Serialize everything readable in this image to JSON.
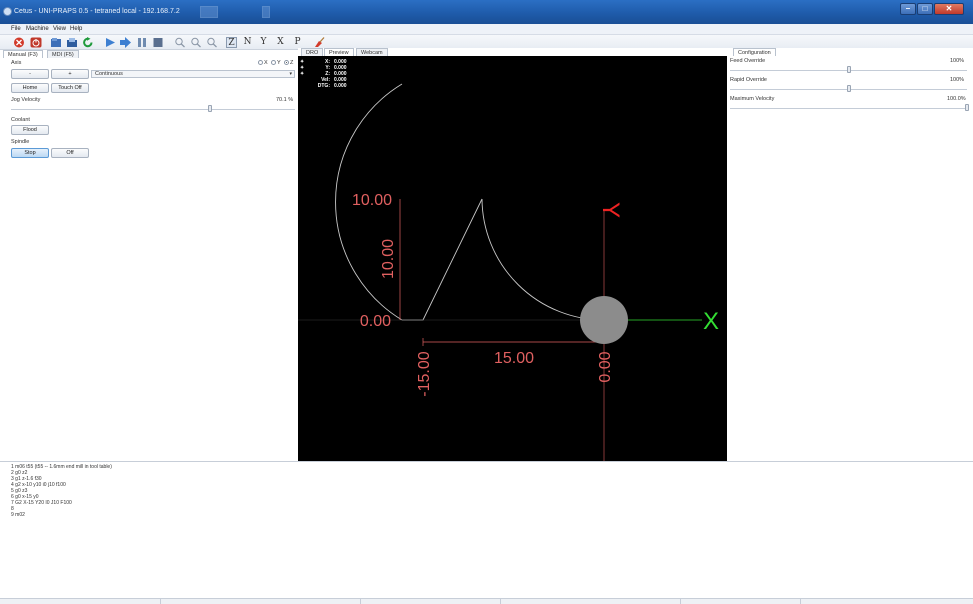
{
  "window": {
    "title": "Cetus - UNI-PRAPS 0.5 - tetraned local - 192.168.7.2"
  },
  "menu": [
    "File",
    "Machine",
    "View",
    "Help"
  ],
  "toolbar": {
    "view_letters": [
      "Z",
      "N",
      "Y",
      "X",
      "P"
    ]
  },
  "left_panel": {
    "tabs": [
      "Manual (F3)",
      "MDI (F5)"
    ],
    "axis_label": "Axis",
    "axis_options": [
      "X",
      "Y",
      "Z"
    ],
    "axis_selected": "Z",
    "jog_minus": "-",
    "jog_plus": "+",
    "jog_mode": "Continuous",
    "home_button": "Home",
    "touch_off_button": "Touch Off",
    "jog_velocity_label": "Jog Velocity",
    "jog_velocity_value": "70.1 %",
    "jog_velocity_fraction": 0.7,
    "coolant_label": "Coolant",
    "flood_button": "Flood",
    "spindle_label": "Spindle",
    "spindle_stop": "Stop",
    "spindle_off": "Off"
  },
  "viewport": {
    "tabs": [
      "DRO",
      "Preview",
      "Webcam"
    ],
    "selected_tab": "Preview",
    "dro": [
      {
        "key": "X:",
        "value": "0.000"
      },
      {
        "key": "Y:",
        "value": "0.000"
      },
      {
        "key": "Z:",
        "value": "0.000"
      },
      {
        "key": "Vel:",
        "value": "0.000"
      },
      {
        "key": "DTG:",
        "value": "0.000"
      }
    ],
    "dims": {
      "height_value": "10.00",
      "height_vertical": "10.00",
      "zero_y": "0.00",
      "x_min": "-15.00",
      "x_span": "15.00",
      "x_zero": "0.00"
    },
    "axis_x_label": "X",
    "axis_y_label": "Y",
    "colors": {
      "background": "#000000",
      "toolpath": "#c8c8c8",
      "dimension": "#e06060",
      "axis_x": "#33dd33",
      "axis_y": "#ee2222",
      "tool": "#8c8c8c"
    }
  },
  "right_panel": {
    "tab": "Configuration",
    "feed_override_label": "Feed Override",
    "feed_override_value": "100%",
    "feed_override_fraction": 0.5,
    "rapid_override_label": "Rapid Override",
    "rapid_override_value": "100%",
    "rapid_override_fraction": 0.5,
    "max_velocity_label": "Maximum Velocity",
    "max_velocity_value": "100.0%",
    "max_velocity_fraction": 1.0
  },
  "gcode": {
    "lines": [
      "1  m06 t55 (t55 -- 1.6mm end mill in tool table)",
      "2  g0 z2",
      "3  g1 z-1.6 f30",
      "4  g2 x-10 y10 i0 j10 f100",
      "5  g0 z3",
      "6  g0 x-15 y0",
      "7  G2 X-15 Y20 I0 J10 F100",
      "8",
      "9  m02"
    ]
  }
}
